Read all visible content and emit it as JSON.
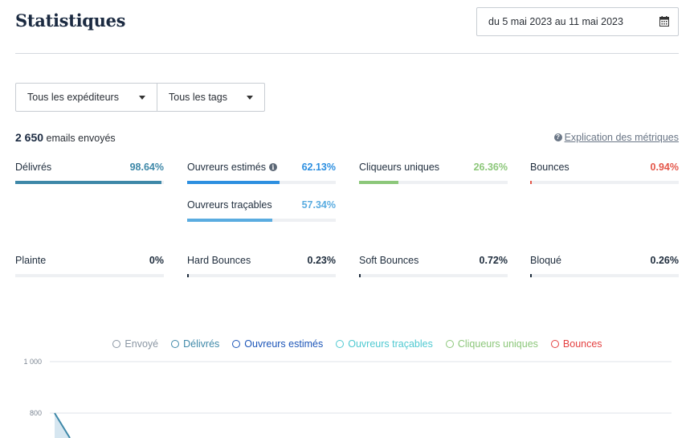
{
  "header": {
    "title": "Statistiques",
    "date_range": "du 5 mai 2023 au 11 mai 2023",
    "calendar_icon": "calendar-icon"
  },
  "filters": {
    "sender": "Tous les expéditeurs",
    "tags": "Tous les tags"
  },
  "summary": {
    "count": "2 650",
    "count_label": "emails envoyés",
    "explain_link": "Explication des métriques"
  },
  "metrics_top": [
    {
      "label": "Délivrés",
      "value": "98.64%",
      "pct": 98.64,
      "color": "#3e88a8"
    },
    {
      "label": "Ouvreurs estimés",
      "value": "62.13%",
      "pct": 62.13,
      "color": "#2d8fe0",
      "info": true
    },
    {
      "label": "Cliqueurs uniques",
      "value": "26.36%",
      "pct": 26.36,
      "color": "#8cc77a"
    },
    {
      "label": "Bounces",
      "value": "0.94%",
      "pct": 0.94,
      "color": "#e4574a"
    }
  ],
  "metric_trackable": {
    "label": "Ouvreurs traçables",
    "value": "57.34%",
    "pct": 57.34,
    "color": "#5aace0"
  },
  "metrics_bottom": [
    {
      "label": "Plainte",
      "value": "0%",
      "pct": 0,
      "color": "#1f2d3d"
    },
    {
      "label": "Hard Bounces",
      "value": "0.23%",
      "pct": 0.23,
      "color": "#1f2d3d"
    },
    {
      "label": "Soft Bounces",
      "value": "0.72%",
      "pct": 0.72,
      "color": "#1f2d3d"
    },
    {
      "label": "Bloqué",
      "value": "0.26%",
      "pct": 0.26,
      "color": "#1f2d3d"
    }
  ],
  "legend": [
    {
      "name": "Envoyé",
      "color": "#8a96a3"
    },
    {
      "name": "Délivrés",
      "color": "#3e88a8"
    },
    {
      "name": "Ouvreurs estimés",
      "color": "#1c55b8"
    },
    {
      "name": "Ouvreurs traçables",
      "color": "#4fc9d1"
    },
    {
      "name": "Cliqueurs uniques",
      "color": "#8cc77a"
    },
    {
      "name": "Bounces",
      "color": "#e44040"
    }
  ],
  "chart_data": {
    "type": "line",
    "y_ticks": [
      "1 000",
      "800"
    ],
    "ylim": [
      0,
      1000
    ],
    "series": [
      {
        "name": "Délivrés",
        "values": [
          800
        ]
      }
    ]
  }
}
